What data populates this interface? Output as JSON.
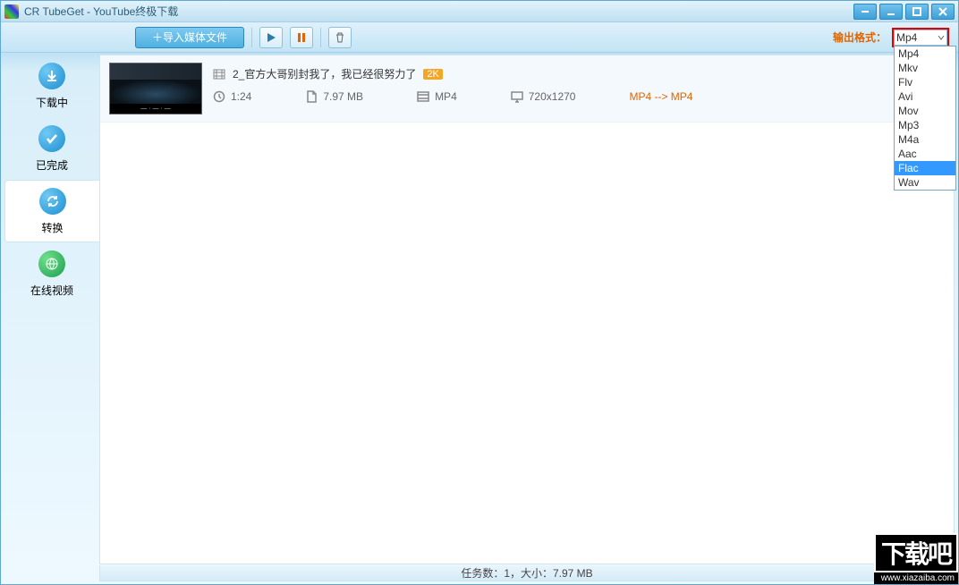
{
  "window": {
    "title": "CR TubeGet - YouTube终极下载"
  },
  "toolbar": {
    "import_label": "＋导入媒体文件",
    "output_label": "输出格式："
  },
  "format": {
    "selected": "Mp4",
    "options": [
      "Mp4",
      "Mkv",
      "Flv",
      "Avi",
      "Mov",
      "Mp3",
      "M4a",
      "Aac",
      "Flac",
      "Wav"
    ],
    "highlighted": "Flac"
  },
  "sidebar": {
    "items": [
      {
        "id": "downloading",
        "label": "下载中",
        "icon": "download"
      },
      {
        "id": "done",
        "label": "已完成",
        "icon": "check"
      },
      {
        "id": "convert",
        "label": "转换",
        "icon": "refresh"
      },
      {
        "id": "online",
        "label": "在线视频",
        "icon": "globe"
      }
    ],
    "active": "convert"
  },
  "item": {
    "title": "2_官方大哥别封我了，我已经很努力了",
    "badge": "2K",
    "duration": "1:24",
    "size": "7.97 MB",
    "format": "MP4",
    "resolution": "720x1270",
    "conversion": "MP4 --> MP4"
  },
  "status": {
    "text": "任务数：1，大小：7.97 MB"
  },
  "watermark": {
    "big": "下载吧",
    "url": "www.xiazaiba.com"
  }
}
